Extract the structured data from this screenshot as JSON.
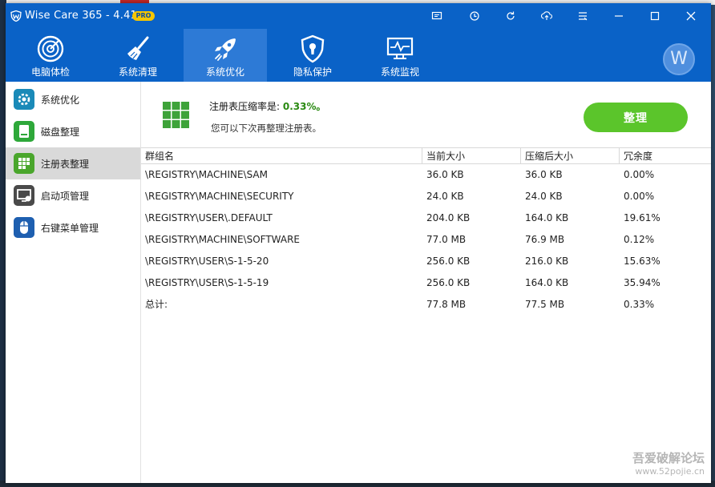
{
  "window": {
    "title": "Wise Care 365 - 4.41",
    "badge": "PRO",
    "title_controls": [
      {
        "name": "feedback-icon"
      },
      {
        "name": "schedule-icon"
      },
      {
        "name": "refresh-icon"
      },
      {
        "name": "upload-icon"
      },
      {
        "name": "menu-icon"
      },
      {
        "name": "minimize-icon"
      },
      {
        "name": "maximize-icon"
      },
      {
        "name": "close-icon"
      }
    ]
  },
  "nav": {
    "items": [
      {
        "label": "电脑体检",
        "icon": "radar-icon"
      },
      {
        "label": "系统清理",
        "icon": "broom-icon"
      },
      {
        "label": "系统优化",
        "icon": "rocket-icon",
        "active": true
      },
      {
        "label": "隐私保护",
        "icon": "shield-icon"
      },
      {
        "label": "系统监视",
        "icon": "monitor-icon"
      }
    ],
    "avatar_letter": "W"
  },
  "sidebar": {
    "items": [
      {
        "label": "系统优化",
        "icon": "gear-icon"
      },
      {
        "label": "磁盘整理",
        "icon": "disk-icon"
      },
      {
        "label": "注册表整理",
        "icon": "registry-grid-icon",
        "active": true
      },
      {
        "label": "启动项管理",
        "icon": "startup-icon"
      },
      {
        "label": "右键菜单管理",
        "icon": "mouse-icon"
      }
    ]
  },
  "main": {
    "ratio_label": "注册表压缩率是:",
    "ratio_value": "0.33%。",
    "hint": "您可以下次再整理注册表。",
    "action_button": "整理"
  },
  "table": {
    "headers": [
      "群组名",
      "当前大小",
      "压缩后大小",
      "冗余度"
    ],
    "rows": [
      [
        "\\REGISTRY\\MACHINE\\SAM",
        "36.0 KB",
        "36.0 KB",
        "0.00%"
      ],
      [
        "\\REGISTRY\\MACHINE\\SECURITY",
        "24.0 KB",
        "24.0 KB",
        "0.00%"
      ],
      [
        "\\REGISTRY\\USER\\.DEFAULT",
        "204.0 KB",
        "164.0 KB",
        "19.61%"
      ],
      [
        "\\REGISTRY\\MACHINE\\SOFTWARE",
        "77.0 MB",
        "76.9 MB",
        "0.12%"
      ],
      [
        "\\REGISTRY\\USER\\S-1-5-20",
        "256.0 KB",
        "216.0 KB",
        "15.63%"
      ],
      [
        "\\REGISTRY\\USER\\S-1-5-19",
        "256.0 KB",
        "164.0 KB",
        "35.94%"
      ],
      [
        "总计:",
        "77.8 MB",
        "77.5 MB",
        "0.33%"
      ]
    ]
  },
  "watermark": {
    "line1": "吾爱破解论坛",
    "line2": "www.52pojie.cn"
  },
  "colors": {
    "titlebar": "#0a62c7",
    "active_nav": "#2d7ad6",
    "accent_green": "#5bc52b",
    "ratio_green": "#2a8a12",
    "sidebar_active": "#d9d9d9"
  }
}
